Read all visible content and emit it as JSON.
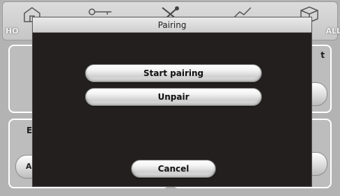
{
  "nav": {
    "items": [
      {
        "label": "HO",
        "icon": "home-icon"
      },
      {
        "label": "",
        "icon": "key-icon"
      },
      {
        "label": "",
        "icon": "settings-tools-icon"
      },
      {
        "label": "",
        "icon": "chart-icon"
      },
      {
        "label": "ALL",
        "icon": "box-icon"
      }
    ]
  },
  "background": {
    "panel_right_label_fragment": "t",
    "panel_bottom_label_fragment": "E",
    "pill_left_label_fragment": "A"
  },
  "dialog": {
    "title": "Pairing",
    "start_pairing_label": "Start pairing",
    "unpair_label": "Unpair",
    "cancel_label": "Cancel"
  },
  "colors": {
    "dialog_background": "#231f1e",
    "title_bar": "#dcdcdc",
    "button_face": "#f0f0f0"
  }
}
